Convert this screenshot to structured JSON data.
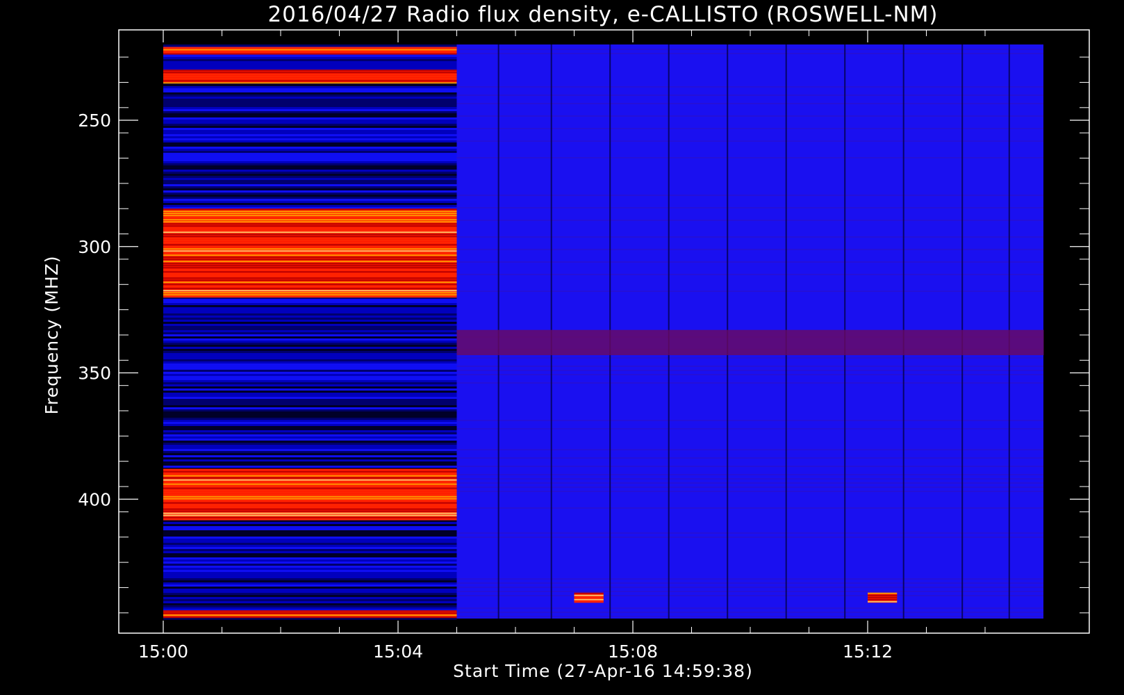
{
  "chart_data": {
    "type": "heatmap",
    "title": "2016/04/27  Radio flux density, e-CALLISTO (ROSWELL-NM)",
    "xlabel": "Start Time (27-Apr-16 14:59:38)",
    "ylabel": "Frequency (MHZ)",
    "x_ticks": [
      "15:00",
      "15:04",
      "15:08",
      "15:12"
    ],
    "y_ticks": [
      "250",
      "300",
      "350",
      "400"
    ],
    "y_axis_reversed": true,
    "colormap": [
      "#000000",
      "#0000ff",
      "#8b0000",
      "#ff0000",
      "#ffa500",
      "#ffff80"
    ],
    "frequency_range_mhz": [
      220,
      447
    ],
    "observation_window": [
      "15:00",
      "15:15"
    ],
    "background_level_change_time": "15:05",
    "features": [
      {
        "name": "strong band",
        "time": [
          "15:00",
          "15:05"
        ],
        "freq_mhz": [
          285,
          320
        ],
        "level": "high"
      },
      {
        "name": "strong band",
        "time": [
          "15:00",
          "15:05"
        ],
        "freq_mhz": [
          388,
          408
        ],
        "level": "high"
      },
      {
        "name": "strong band",
        "time": [
          "15:00",
          "15:05"
        ],
        "freq_mhz": [
          221,
          224
        ],
        "level": "high"
      },
      {
        "name": "strong band",
        "time": [
          "15:00",
          "15:05"
        ],
        "freq_mhz": [
          230,
          235
        ],
        "level": "high"
      },
      {
        "name": "strong band",
        "time": [
          "15:00",
          "15:05"
        ],
        "freq_mhz": [
          444,
          447
        ],
        "level": "high"
      },
      {
        "name": "burst patch",
        "time": [
          "15:07",
          "15:07.5"
        ],
        "freq_mhz": [
          437,
          441
        ],
        "level": "high"
      },
      {
        "name": "burst patch",
        "time": [
          "15:12",
          "15:12.5"
        ],
        "freq_mhz": [
          437,
          441
        ],
        "level": "high"
      },
      {
        "name": "enhanced band",
        "time": [
          "15:05",
          "15:15"
        ],
        "freq_mhz": [
          333,
          343
        ],
        "level": "medium"
      }
    ]
  }
}
